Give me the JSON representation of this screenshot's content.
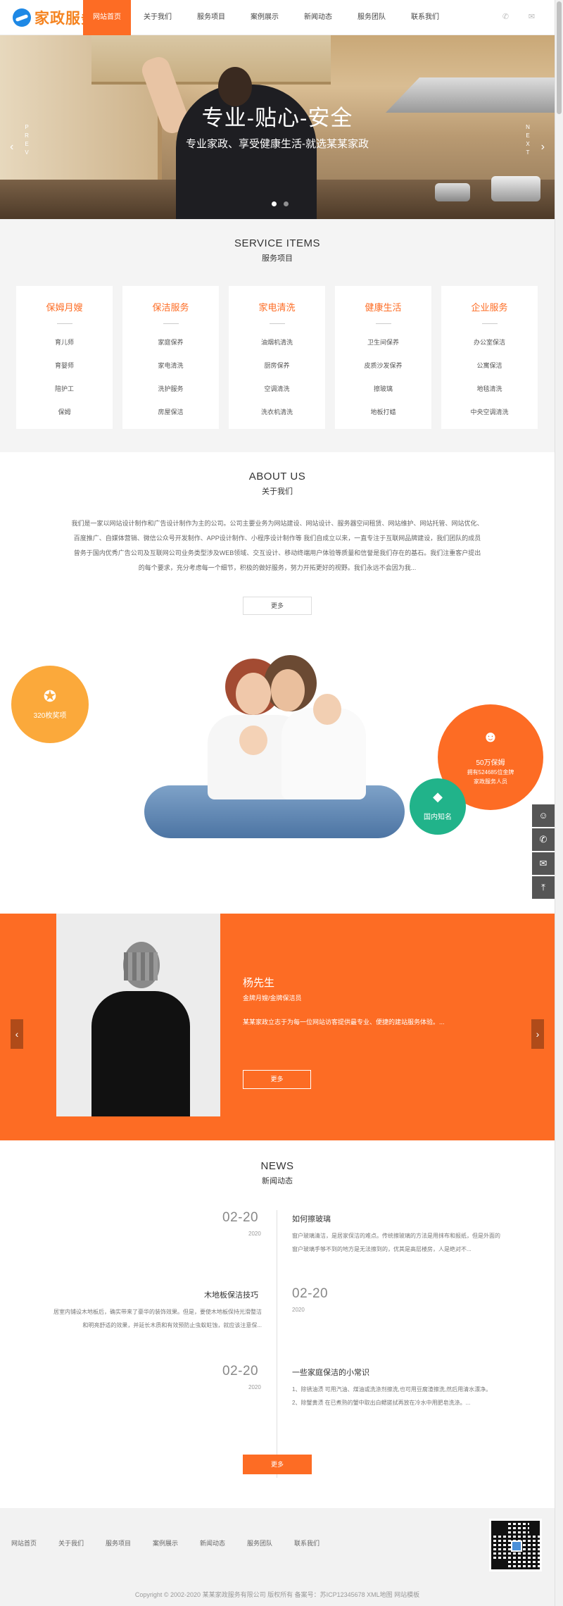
{
  "header": {
    "logo_text": "家政服务",
    "nav": [
      "网站首页",
      "关于我们",
      "服务项目",
      "案例展示",
      "新闻动态",
      "服务团队",
      "联系我们"
    ]
  },
  "banner": {
    "title": "专业-贴心-安全",
    "subtitle": "专业家政、享受健康生活-就选某某家政",
    "prev": [
      "P",
      "R",
      "E",
      "V"
    ],
    "next": [
      "N",
      "E",
      "X",
      "T"
    ]
  },
  "services": {
    "title_en": "SERVICE ITEMS",
    "title_cn": "服务项目",
    "cards": [
      {
        "title": "保姆月嫂",
        "items": [
          "育儿师",
          "育婴师",
          "陪护工",
          "保姆"
        ]
      },
      {
        "title": "保洁服务",
        "items": [
          "家庭保养",
          "家电清洗",
          "洗护服务",
          "房屋保洁"
        ]
      },
      {
        "title": "家电清洗",
        "items": [
          "油烟机清洗",
          "厨房保养",
          "空调清洗",
          "洗衣机清洗"
        ]
      },
      {
        "title": "健康生活",
        "items": [
          "卫生间保养",
          "皮质沙发保养",
          "擦玻璃",
          "地板打蜡"
        ]
      },
      {
        "title": "企业服务",
        "items": [
          "办公室保洁",
          "公寓保洁",
          "地毯清洗",
          "中央空调清洗"
        ]
      }
    ]
  },
  "about": {
    "title_en": "ABOUT US",
    "title_cn": "关于我们",
    "lines": [
      "我们是一家以网站设计制作和广告设计制作为主的公司。公司主要业务为网站建设、网站设计、服务器空间租赁、网站维护、网站托管、网站优化、",
      "百度推广、自媒体营销、微信公众号开发制作、APP设计制作、小程序设计制作等 我们自成立以来，一直专注于互联网品牌建设，我们团队的成员",
      "曾务于国内优秀广告公司及互联网公司业务类型涉及WEB领域、交互设计、移动终端用户体验等质量和信誉是我们存在的基石。我们注重客户提出",
      "的每个要求，充分考虑每一个细节，积极的做好服务，努力开拓更好的视野。我们永远不会因为我..."
    ],
    "more": "更多",
    "badge1": "320枚奖项",
    "badge2_title": "50万保姆",
    "badge2_sub": [
      "拥有524685位金牌",
      "家政服务人员"
    ],
    "badge3": "国内知名"
  },
  "team": {
    "name": "杨先生",
    "role": "金牌月嫂/金牌保洁员",
    "desc": "某某家政立志于为每一位网站访客提供最专业、便捷的建站服务体验。...",
    "more": "更多"
  },
  "news": {
    "title_en": "NEWS",
    "title_cn": "新闻动态",
    "items": [
      {
        "date": "02-20",
        "year": "2020",
        "title": "如何擦玻璃",
        "body": [
          "窗户玻璃清洁，是居家保洁的难点。传统擦玻璃的方法是用抹布和报纸，但是外面的",
          "窗户玻璃手够不到的地方是无法擦到的，优其是高层楼房，人是绝对不..."
        ]
      },
      {
        "date": "02-20",
        "year": "2020",
        "title": "木地板保洁技巧",
        "body": [
          "居室内铺设木地板后，确实带来了豪华的装饰效果。但是，要使木地板保持光滑整洁",
          "和明亮舒适的效果，并延长木质和有效预防止虫蚁蛀蚀，就应该注意保..."
        ]
      },
      {
        "date": "02-20",
        "year": "2020",
        "title": "一些家庭保洁的小常识",
        "body": [
          "1、除锈油渍 可用汽油、煤油或洗涤剂擦洗,也可用豆腐渣擦洗,然后用清水漂净。",
          "2、除蟹黄渍 在已煮熟的蟹中取出白鳃搓拭再放在冷水中用肥皂洗涤。..."
        ]
      }
    ],
    "more": "更多"
  },
  "footer": {
    "nav": [
      "网站首页",
      "关于我们",
      "服务项目",
      "案例展示",
      "新闻动态",
      "服务团队",
      "联系我们"
    ],
    "copyright": "Copyright © 2002-2020 某某家政服务有限公司 版权所有 备案号：苏ICP12345678 XML地图 网站模板"
  }
}
